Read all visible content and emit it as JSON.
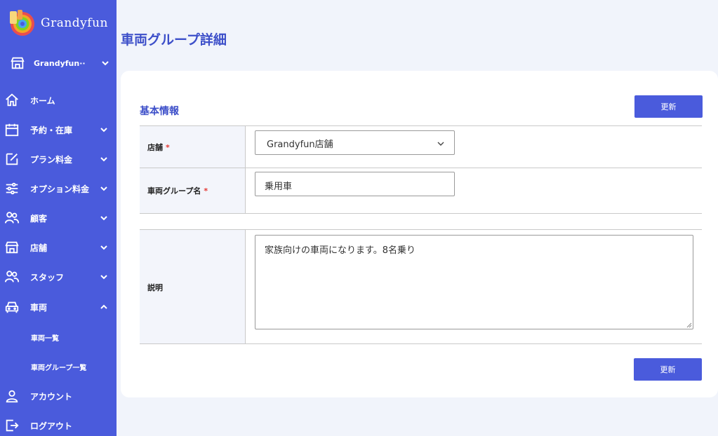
{
  "brand": {
    "name": "Grandyfun"
  },
  "store_selector": {
    "label": "Grandyfun···"
  },
  "nav": {
    "home": "ホーム",
    "reservation": "予約・在庫",
    "plan": "プラン料金",
    "option": "オプション料金",
    "customer": "顧客",
    "store": "店舗",
    "staff": "スタッフ",
    "vehicle": "車両",
    "vehicle_list": "車両一覧",
    "vehicle_group_list": "車両グループ一覧",
    "account": "アカウント",
    "logout": "ログアウト"
  },
  "page": {
    "title": "車両グループ詳細"
  },
  "section": {
    "title": "基本情報"
  },
  "buttons": {
    "update_top": "更新",
    "update_bottom": "更新"
  },
  "form": {
    "store": {
      "label": "店舗",
      "required": "*",
      "value": "Grandyfun店舗"
    },
    "group_name": {
      "label": "車両グループ名",
      "required": "*",
      "value": "乗用車"
    },
    "description": {
      "label": "説明",
      "value": "家族向けの車両になります。8名乗り"
    }
  },
  "colors": {
    "primary": "#4a5bdc",
    "title": "#3d4fc9",
    "required": "#e53935",
    "background": "#f1f4fb"
  }
}
